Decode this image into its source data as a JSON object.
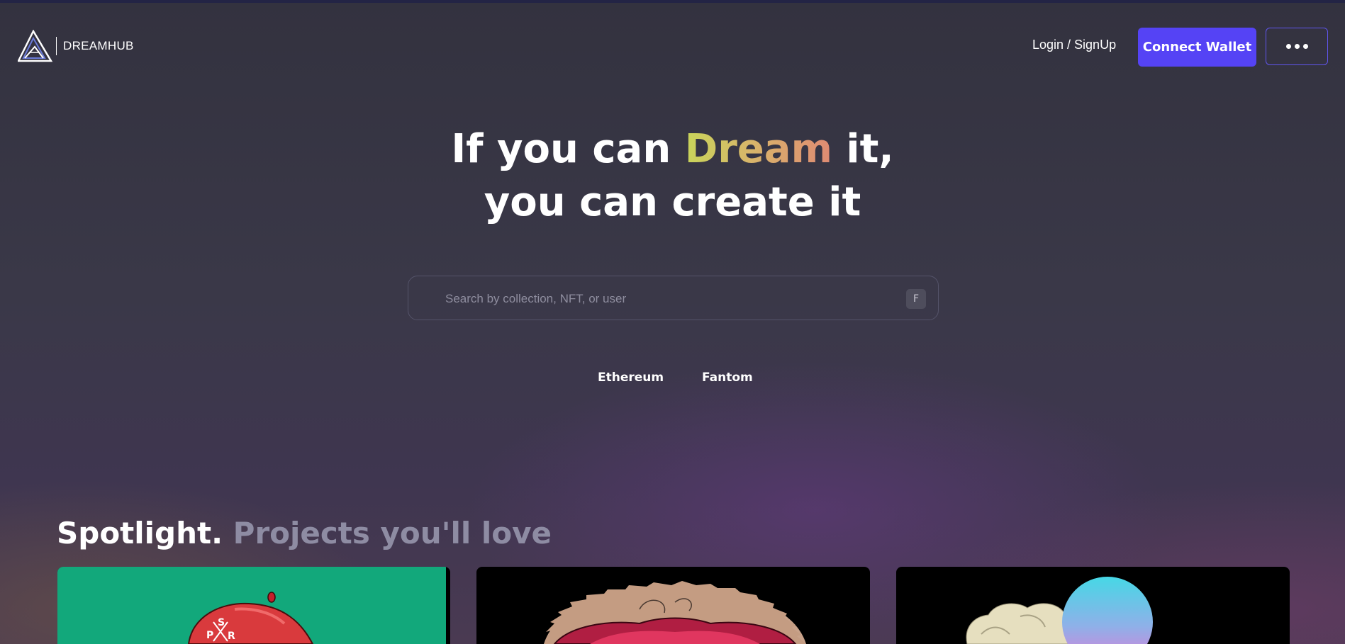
{
  "brand": {
    "name": "DREAMHUB",
    "logo_icon": "triangle-logo-icon"
  },
  "header": {
    "login_label": "Login / SignUp",
    "connect_label": "Connect Wallet",
    "more_icon": "more-dots-icon"
  },
  "hero": {
    "line1_prefix": "If you can ",
    "line1_highlight": "Dream",
    "line1_suffix": " it,",
    "line2": "you can create it"
  },
  "search": {
    "placeholder": "Search by collection, NFT, or user",
    "value": "",
    "shortcut_key": "F"
  },
  "chains": [
    "Ethereum",
    "Fantom"
  ],
  "spotlight": {
    "title": "Spotlight.",
    "subtitle": "Projects you'll love"
  },
  "colors": {
    "accent": "#5543f5",
    "dream_gradient_start": "#c9d55a",
    "dream_gradient_end": "#df8a73",
    "card1_bg": "#12a87b"
  }
}
